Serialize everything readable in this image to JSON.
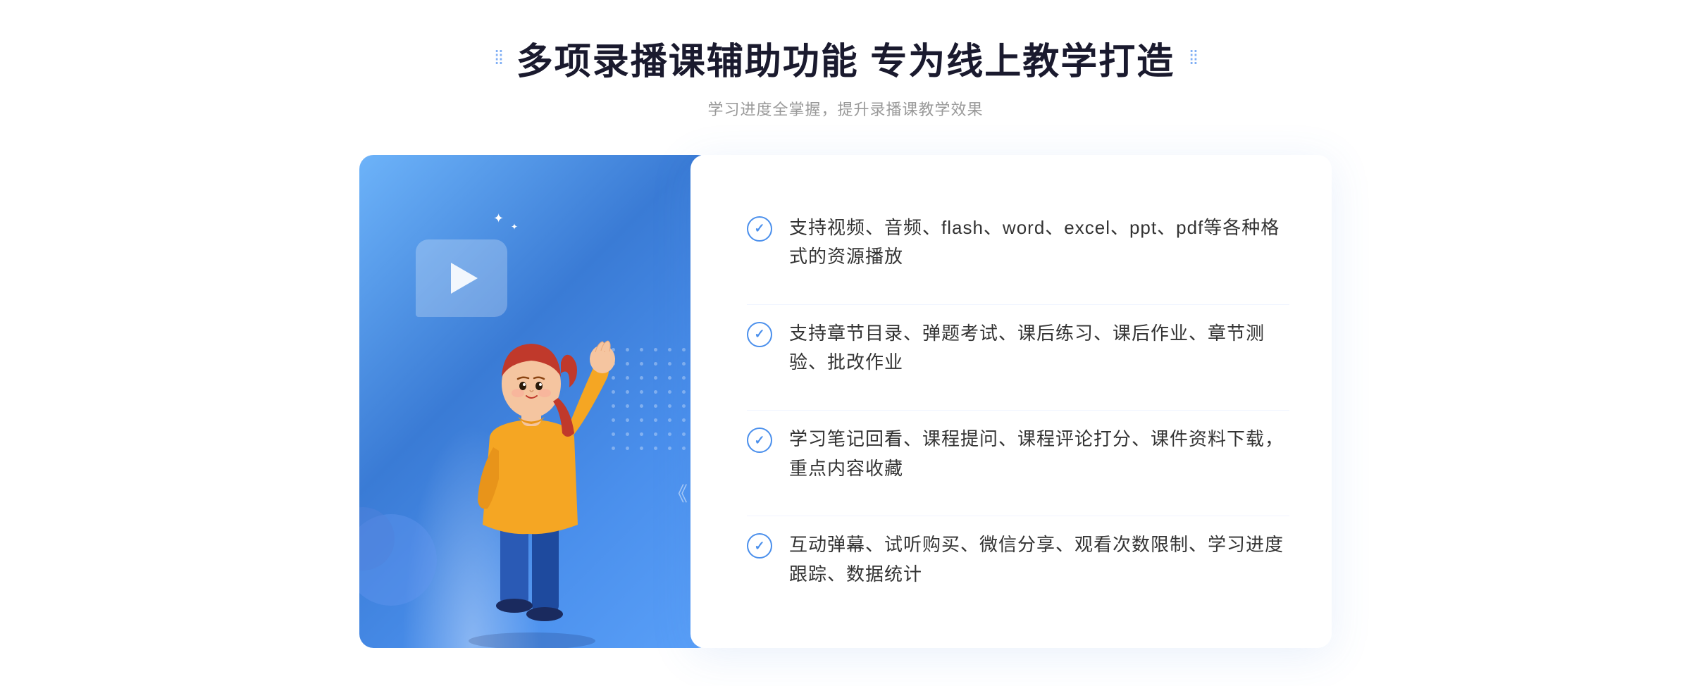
{
  "header": {
    "title": "多项录播课辅助功能 专为线上教学打造",
    "subtitle": "学习进度全掌握，提升录播课教学效果",
    "dots_left": "⁞⁞",
    "dots_right": "⁞⁞"
  },
  "features": [
    {
      "id": 1,
      "text": "支持视频、音频、flash、word、excel、ppt、pdf等各种格式的资源播放"
    },
    {
      "id": 2,
      "text": "支持章节目录、弹题考试、课后练习、课后作业、章节测验、批改作业"
    },
    {
      "id": 3,
      "text": "学习笔记回看、课程提问、课程评论打分、课件资料下载，重点内容收藏"
    },
    {
      "id": 4,
      "text": "互动弹幕、试听购买、微信分享、观看次数限制、学习进度跟踪、数据统计"
    }
  ],
  "icons": {
    "check": "✓",
    "play": "▶",
    "chevron_left": "《"
  }
}
